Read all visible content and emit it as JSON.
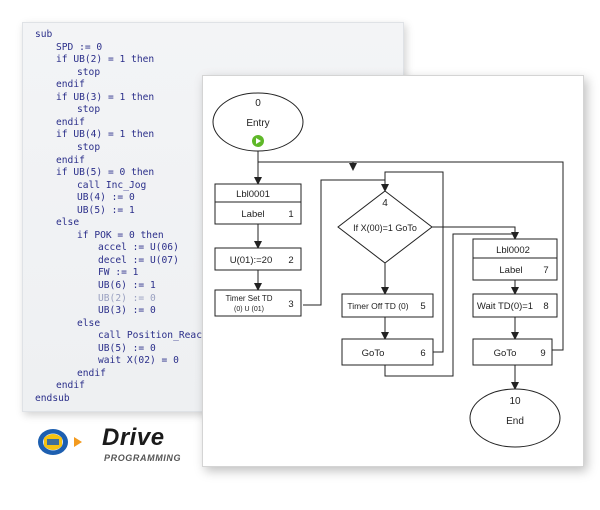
{
  "code_lines": [
    {
      "text": "sub",
      "indent": 0
    },
    {
      "text": "SPD := 0",
      "indent": 1
    },
    {
      "text": "if UB(2) = 1 then",
      "indent": 1
    },
    {
      "text": "stop",
      "indent": 2
    },
    {
      "text": "endif",
      "indent": 1
    },
    {
      "text": "if UB(3) = 1 then",
      "indent": 1
    },
    {
      "text": "stop",
      "indent": 2
    },
    {
      "text": "endif",
      "indent": 1
    },
    {
      "text": "if UB(4) = 1 then",
      "indent": 1
    },
    {
      "text": "stop",
      "indent": 2
    },
    {
      "text": "endif",
      "indent": 1
    },
    {
      "text": "if UB(5) = 0 then",
      "indent": 1
    },
    {
      "text": "call Inc_Jog",
      "indent": 2
    },
    {
      "text": "UB(4) := 0",
      "indent": 2
    },
    {
      "text": "UB(5) := 1",
      "indent": 2
    },
    {
      "text": "else",
      "indent": 1
    },
    {
      "text": "if POK = 0 then",
      "indent": 2
    },
    {
      "text": "accel := U(06)",
      "indent": 3
    },
    {
      "text": "decel := U(07)",
      "indent": 3
    },
    {
      "text": "FW := 1",
      "indent": 3
    },
    {
      "text": "UB(6) := 1",
      "indent": 3
    },
    {
      "text": "UB(2) := 0",
      "indent": 3,
      "dim": true
    },
    {
      "text": "UB(3) := 0",
      "indent": 3
    },
    {
      "text": "else",
      "indent": 2
    },
    {
      "text": "call Position_Reac",
      "indent": 3
    },
    {
      "text": "UB(5) := 0",
      "indent": 3
    },
    {
      "text": "wait X(02) = 0",
      "indent": 3
    },
    {
      "text": "endif",
      "indent": 2
    },
    {
      "text": "endif",
      "indent": 1
    },
    {
      "text": "endsub",
      "indent": 0
    }
  ],
  "flowchart": {
    "entry": {
      "number": "0",
      "label": "Entry"
    },
    "end": {
      "number": "10",
      "label": "End"
    },
    "label1": {
      "name": "Lbl0001",
      "type": "Label",
      "number": "1"
    },
    "assign": {
      "text": "U(01):=20",
      "number": "2"
    },
    "timer_set": {
      "line1": "Timer Set TD",
      "line2": "(0) U (01)",
      "number": "3"
    },
    "decision": {
      "number": "4",
      "text": "If X(00)=1 GoTo"
    },
    "timer_off": {
      "text": "Timer Off TD (0)",
      "number": "5"
    },
    "goto1": {
      "text": "GoTo",
      "number": "6"
    },
    "label2": {
      "name": "Lbl0002",
      "type": "Label",
      "number": "7"
    },
    "wait": {
      "text": "Wait TD(0)=1",
      "number": "8"
    },
    "goto2": {
      "text": "GoTo",
      "number": "9"
    }
  },
  "logo": {
    "word": "Drive",
    "subtitle": "PROGRAMMING"
  },
  "colors": {
    "code_text": "#2b2f8a",
    "code_dim": "#9aa0c0",
    "play_green": "#5fb829",
    "logo_blue": "#1d5fb0",
    "logo_yellow": "#f5c211",
    "arrow_orange": "#f39a1e"
  }
}
